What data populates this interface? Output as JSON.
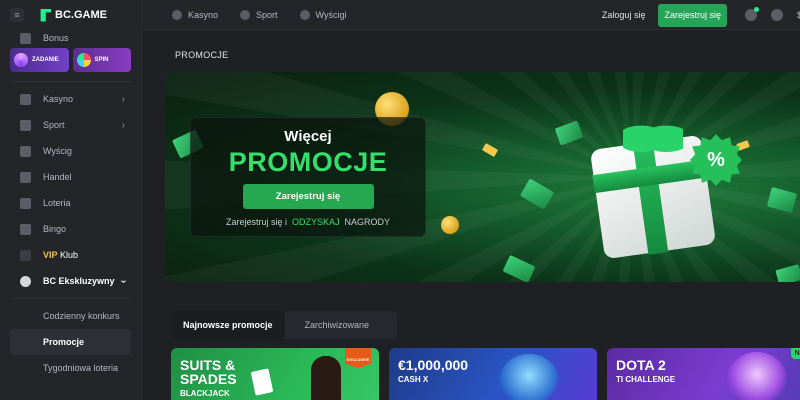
{
  "header": {
    "logo_text": "BC.GAME",
    "nav": [
      {
        "label": "Kasyno",
        "icon": "casino-icon"
      },
      {
        "label": "Sport",
        "icon": "sport-icon"
      },
      {
        "label": "Wyścigi",
        "icon": "racing-icon"
      }
    ],
    "login_label": "Zaloguj się",
    "register_label": "Zarejestruj się",
    "currency_symbol": "$"
  },
  "sidebar": {
    "bonus_label": "Bonus",
    "tiles": [
      {
        "label": "ZADANIE"
      },
      {
        "label": "SPIN"
      }
    ],
    "items": [
      {
        "label": "Kasyno",
        "chevron": true
      },
      {
        "label": "Sport",
        "chevron": true
      },
      {
        "label": "Wyścig"
      },
      {
        "label": "Handel"
      },
      {
        "label": "Loteria"
      },
      {
        "label": "Bingo"
      }
    ],
    "vip_prefix": "VIP",
    "vip_suffix": "Klub",
    "exclusive_label": "BC Ekskluzywny",
    "sub_items": [
      {
        "label": "Codzienny konkurs"
      },
      {
        "label": "Promocje",
        "active": true
      },
      {
        "label": "Tygodniowa loteria"
      }
    ]
  },
  "main": {
    "page_title": "PROMOCJE",
    "banner": {
      "line1": "Więcej",
      "line2": "PROMOCJE",
      "button_label": "Zarejestruj się",
      "caption_part1": "Zarejestruj się i",
      "caption_highlight": "ODZYSKAJ",
      "caption_part2": "NAGRODY",
      "badge_text": "%"
    },
    "tabs": [
      {
        "label": "Najnowsze promocje",
        "active": true
      },
      {
        "label": "Zarchiwizowane",
        "active": false
      }
    ],
    "cards": [
      {
        "title_line1": "SUITS &",
        "title_line2": "SPADES",
        "subtitle": "BLACKJACK",
        "badge": "EXCLUSIVE"
      },
      {
        "title_line1": "€1,000,000",
        "subtitle": "CASH X"
      },
      {
        "title_line1": "DOTA 2",
        "subtitle": "TI CHALLENGE",
        "badge": "NEW"
      }
    ]
  },
  "colors": {
    "accent_green": "#24ee89",
    "button_green": "#25a84f",
    "background": "#1e2024",
    "sidebar_bg": "#232529",
    "vip_gold": "#f0c14b"
  }
}
